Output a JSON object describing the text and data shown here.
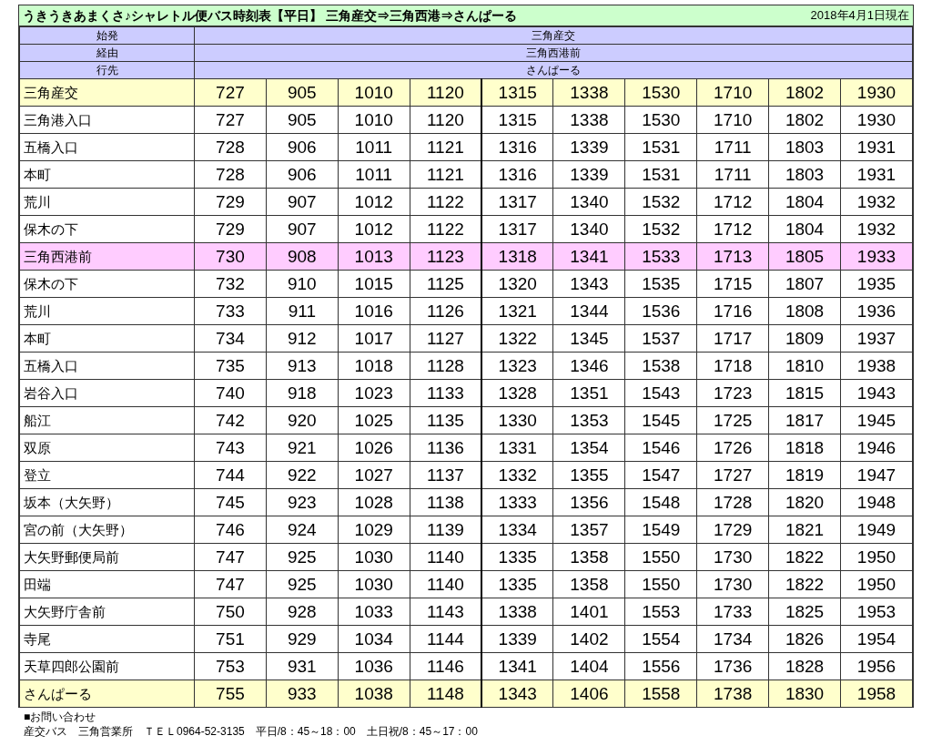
{
  "title": "うきうきあまくさ♪シャレトル便バス時刻表【平日】 三角産交⇒三角西港⇒さんぱーる",
  "as_of": "2018年4月1日現在",
  "header_rows": [
    {
      "label": "始発",
      "value": "三角産交"
    },
    {
      "label": "経由",
      "value": "三角西港前"
    },
    {
      "label": "行先",
      "value": "さんぱーる"
    }
  ],
  "rows": [
    {
      "stop": "三角産交",
      "kind": "terminal",
      "times": [
        "727",
        "905",
        "1010",
        "1120",
        "1315",
        "1338",
        "1530",
        "1710",
        "1802",
        "1930"
      ]
    },
    {
      "stop": "三角港入口",
      "kind": "normal",
      "times": [
        "727",
        "905",
        "1010",
        "1120",
        "1315",
        "1338",
        "1530",
        "1710",
        "1802",
        "1930"
      ]
    },
    {
      "stop": "五橋入口",
      "kind": "normal",
      "times": [
        "728",
        "906",
        "1011",
        "1121",
        "1316",
        "1339",
        "1531",
        "1711",
        "1803",
        "1931"
      ]
    },
    {
      "stop": "本町",
      "kind": "normal",
      "times": [
        "728",
        "906",
        "1011",
        "1121",
        "1316",
        "1339",
        "1531",
        "1711",
        "1803",
        "1931"
      ]
    },
    {
      "stop": "荒川",
      "kind": "normal",
      "times": [
        "729",
        "907",
        "1012",
        "1122",
        "1317",
        "1340",
        "1532",
        "1712",
        "1804",
        "1932"
      ]
    },
    {
      "stop": "保木の下",
      "kind": "normal",
      "times": [
        "729",
        "907",
        "1012",
        "1122",
        "1317",
        "1340",
        "1532",
        "1712",
        "1804",
        "1932"
      ]
    },
    {
      "stop": "三角西港前",
      "kind": "via",
      "times": [
        "730",
        "908",
        "1013",
        "1123",
        "1318",
        "1341",
        "1533",
        "1713",
        "1805",
        "1933"
      ]
    },
    {
      "stop": "保木の下",
      "kind": "normal",
      "times": [
        "732",
        "910",
        "1015",
        "1125",
        "1320",
        "1343",
        "1535",
        "1715",
        "1807",
        "1935"
      ]
    },
    {
      "stop": "荒川",
      "kind": "normal",
      "times": [
        "733",
        "911",
        "1016",
        "1126",
        "1321",
        "1344",
        "1536",
        "1716",
        "1808",
        "1936"
      ]
    },
    {
      "stop": "本町",
      "kind": "normal",
      "times": [
        "734",
        "912",
        "1017",
        "1127",
        "1322",
        "1345",
        "1537",
        "1717",
        "1809",
        "1937"
      ]
    },
    {
      "stop": "五橋入口",
      "kind": "normal",
      "times": [
        "735",
        "913",
        "1018",
        "1128",
        "1323",
        "1346",
        "1538",
        "1718",
        "1810",
        "1938"
      ]
    },
    {
      "stop": "岩谷入口",
      "kind": "normal",
      "times": [
        "740",
        "918",
        "1023",
        "1133",
        "1328",
        "1351",
        "1543",
        "1723",
        "1815",
        "1943"
      ]
    },
    {
      "stop": "船江",
      "kind": "normal",
      "times": [
        "742",
        "920",
        "1025",
        "1135",
        "1330",
        "1353",
        "1545",
        "1725",
        "1817",
        "1945"
      ]
    },
    {
      "stop": "双原",
      "kind": "normal",
      "times": [
        "743",
        "921",
        "1026",
        "1136",
        "1331",
        "1354",
        "1546",
        "1726",
        "1818",
        "1946"
      ]
    },
    {
      "stop": "登立",
      "kind": "normal",
      "times": [
        "744",
        "922",
        "1027",
        "1137",
        "1332",
        "1355",
        "1547",
        "1727",
        "1819",
        "1947"
      ]
    },
    {
      "stop": "坂本（大矢野）",
      "kind": "normal",
      "times": [
        "745",
        "923",
        "1028",
        "1138",
        "1333",
        "1356",
        "1548",
        "1728",
        "1820",
        "1948"
      ]
    },
    {
      "stop": "宮の前（大矢野）",
      "kind": "normal",
      "times": [
        "746",
        "924",
        "1029",
        "1139",
        "1334",
        "1357",
        "1549",
        "1729",
        "1821",
        "1949"
      ]
    },
    {
      "stop": "大矢野郵便局前",
      "kind": "normal",
      "times": [
        "747",
        "925",
        "1030",
        "1140",
        "1335",
        "1358",
        "1550",
        "1730",
        "1822",
        "1950"
      ]
    },
    {
      "stop": "田端",
      "kind": "normal",
      "times": [
        "747",
        "925",
        "1030",
        "1140",
        "1335",
        "1358",
        "1550",
        "1730",
        "1822",
        "1950"
      ]
    },
    {
      "stop": "大矢野庁舎前",
      "kind": "normal",
      "times": [
        "750",
        "928",
        "1033",
        "1143",
        "1338",
        "1401",
        "1553",
        "1733",
        "1825",
        "1953"
      ]
    },
    {
      "stop": "寺尾",
      "kind": "normal",
      "times": [
        "751",
        "929",
        "1034",
        "1144",
        "1339",
        "1402",
        "1554",
        "1734",
        "1826",
        "1954"
      ]
    },
    {
      "stop": "天草四郎公園前",
      "kind": "normal",
      "times": [
        "753",
        "931",
        "1036",
        "1146",
        "1341",
        "1404",
        "1556",
        "1736",
        "1828",
        "1956"
      ]
    },
    {
      "stop": "さんぱーる",
      "kind": "terminal",
      "times": [
        "755",
        "933",
        "1038",
        "1148",
        "1343",
        "1406",
        "1558",
        "1738",
        "1830",
        "1958"
      ]
    }
  ],
  "footer": [
    "■お問い合わせ",
    "産交バス　三角営業所　ＴＥＬ0964-52-3135　平日/8：45～18：00　土日祝/8：45～17：00"
  ]
}
